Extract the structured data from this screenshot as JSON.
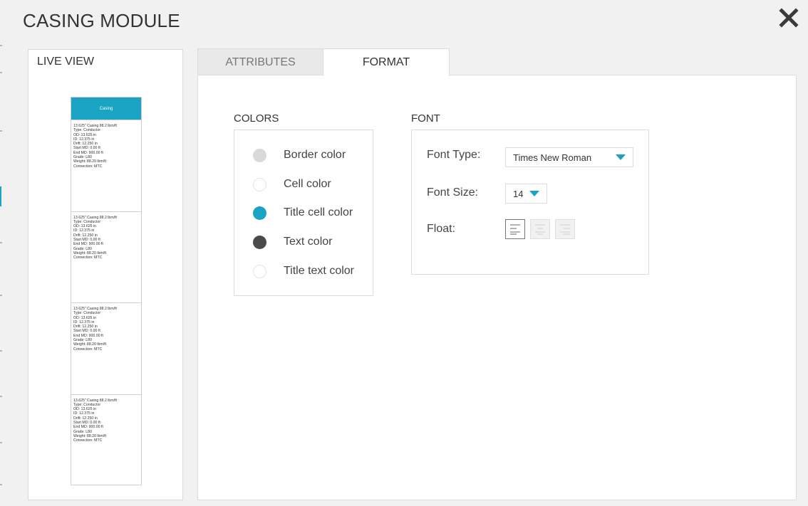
{
  "window": {
    "title": "CASING MODULE",
    "close_icon": "close-icon"
  },
  "live_view": {
    "title": "LIVE VIEW",
    "preview_header": "Casing",
    "cells": [
      [
        "13.625\" Casing 88.2 lbm/ft",
        "Type: Conductor",
        "OD: 13.625 in",
        "ID: 12.375 in",
        "Drift: 12.250 in",
        "Start MD: 0.00 ft",
        "End MD: 900.00 ft",
        "Grade: L80",
        "Weight: 88.20 lbm/ft",
        "Connection: MTC"
      ],
      [
        "13.625\" Casing 88.2 lbm/ft",
        "Type: Conductor",
        "OD: 13.625 in",
        "ID: 12.375 in",
        "Drift: 12.250 in",
        "Start MD: 0.00 ft",
        "End MD: 900.00 ft",
        "Grade: L80",
        "Weight: 88.20 lbm/ft",
        "Connection: MTC"
      ],
      [
        "13.625\" Casing 88.2 lbm/ft",
        "Type: Conductor",
        "OD: 13.625 in",
        "ID: 12.375 in",
        "Drift: 12.250 in",
        "Start MD: 0.00 ft",
        "End MD: 900.00 ft",
        "Grade: L80",
        "Weight: 88.20 lbm/ft",
        "Connection: MTC"
      ],
      [
        "13.625\" Casing 88.2 lbm/ft",
        "Type: Conductor",
        "OD: 13.625 in",
        "ID: 12.375 in",
        "Drift: 12.250 in",
        "Start MD: 0.00 ft",
        "End MD: 900.00 ft",
        "Grade: L80",
        "Weight: 88.20 lbm/ft",
        "Connection: MTC"
      ]
    ]
  },
  "tabs": [
    {
      "label": "ATTRIBUTES",
      "active": false
    },
    {
      "label": "FORMAT",
      "active": true
    }
  ],
  "colors": {
    "title": "COLORS",
    "items": [
      {
        "label": "Border color",
        "color": "#d9d9d9"
      },
      {
        "label": "Cell color",
        "color": "#ffffff"
      },
      {
        "label": "Title cell color",
        "color": "#1aa3c2"
      },
      {
        "label": "Text color",
        "color": "#4a4a4a"
      },
      {
        "label": "Title text color",
        "color": "#ffffff"
      }
    ]
  },
  "font": {
    "title": "FONT",
    "type_label": "Font Type:",
    "type_value": "Times New Roman",
    "size_label": "Font Size:",
    "size_value": "14",
    "float_label": "Float:",
    "float_options": [
      {
        "icon": "align-left-icon",
        "active": true
      },
      {
        "icon": "align-center-icon",
        "active": false
      },
      {
        "icon": "align-right-icon",
        "active": false
      }
    ]
  },
  "accent_color": "#1aa3c2"
}
